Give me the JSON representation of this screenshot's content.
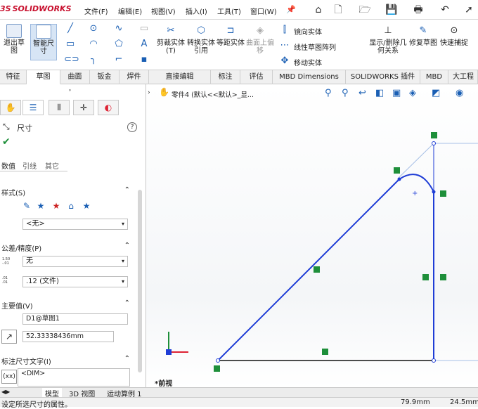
{
  "app": {
    "logo_text": "SOLIDWORKS",
    "logo_mark": "3S"
  },
  "menu": [
    "文件(F)",
    "编辑(E)",
    "视图(V)",
    "插入(I)",
    "工具(T)",
    "窗口(W)"
  ],
  "ribbon": {
    "exit_sketch": "退出草图",
    "smart_dimension": "智能尺寸",
    "trim": "剪裁实体(T)",
    "convert": "转换实体引用",
    "offset": "等距实体",
    "offset_surface": "曲面上偏移",
    "mirror": "镜向实体",
    "linear_pattern": "线性草图阵列",
    "move": "移动实体",
    "display_relations": "显示/删除几何关系",
    "repair": "修复草图",
    "quick_snaps": "快速捕捉"
  },
  "tabs": [
    "特征",
    "草图",
    "曲面",
    "钣金",
    "焊件",
    "直接编辑",
    "标注",
    "评估",
    "MBD Dimensions",
    "SOLIDWORKS 插件",
    "MBD",
    "大工程"
  ],
  "active_tab": "草图",
  "panel": {
    "title": "尺寸",
    "subtabs": [
      "数值",
      "引线",
      "其它"
    ],
    "style_label": "样式(S)",
    "style_value": "<无>",
    "tolerance_label": "公差/精度(P)",
    "tolerance_value": "无",
    "precision_value": ".12 (文件)",
    "primary_label": "主要值(V)",
    "dim_name": "D1@草图1",
    "dim_value": "52.33338436mm",
    "text_label": "标注尺寸文字(I)",
    "dim_text": "<DIM>",
    "tol_tiny": "1.50\n-.01",
    "prec_tiny": ".01\n.01"
  },
  "viewport": {
    "title": "零件4  (默认<<默认>_显...",
    "view_label": "*前视"
  },
  "bottom_tabs": [
    "模型",
    "3D 视图",
    "运动算例 1"
  ],
  "status": {
    "text": "设定所选尺寸的属性。",
    "x": "79.9mm",
    "y": "24.5mm"
  },
  "colors": {
    "sketch_line": "#1f3dd6",
    "relation_badge": "#1e8f3a",
    "tab_bg": "#f0f0f0",
    "logo_red": "#c8102e"
  }
}
